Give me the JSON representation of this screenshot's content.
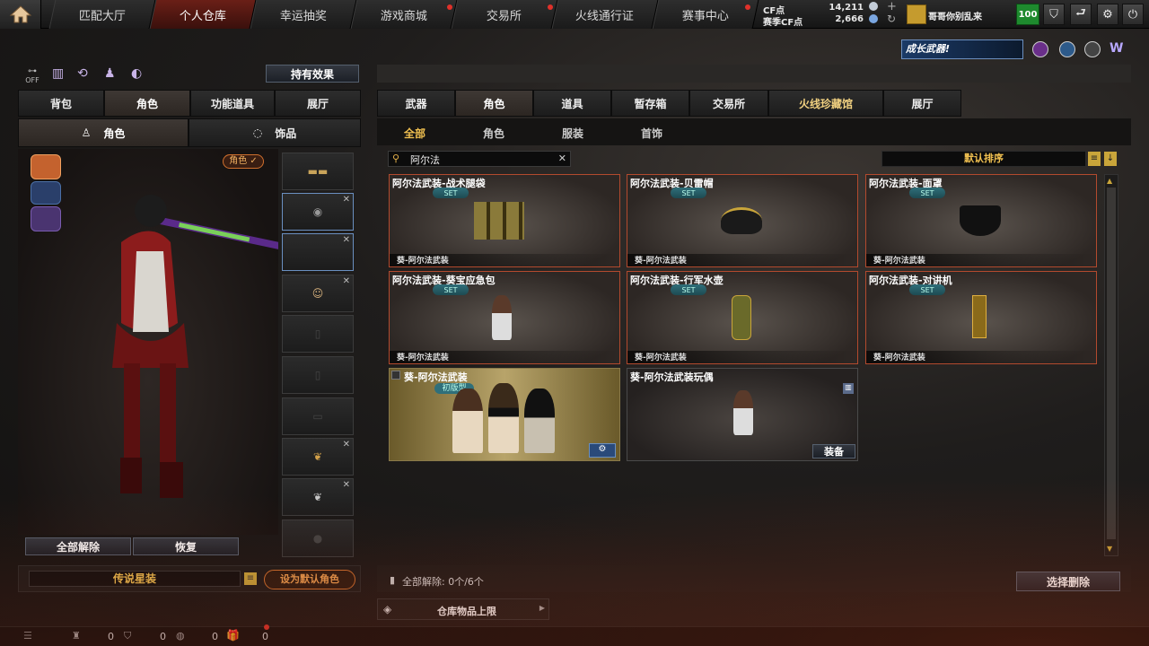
{
  "topnav": {
    "tabs": [
      "匹配大厅",
      "个人仓库",
      "幸运抽奖",
      "游戏商城",
      "交易所",
      "火线通行证",
      "赛事中心"
    ],
    "active": 1,
    "currency": {
      "cf_label": "CF点",
      "cf_value": "14,211",
      "match_label": "赛季CF点",
      "match_value": "2,666"
    },
    "username": "哥哥你别乱来",
    "level": "100"
  },
  "banner": {
    "text": "成长武器!"
  },
  "left": {
    "effect_button": "持有效果",
    "off_label": "OFF",
    "main_tabs": [
      "背包",
      "角色",
      "功能道具",
      "展厅"
    ],
    "main_active": 1,
    "sub_tabs": [
      "角色",
      "饰品"
    ],
    "role_badge": "角色 ✓",
    "clear_all": "全部解除",
    "restore": "恢复",
    "preset_name": "传说星装",
    "set_default": "设为默认角色"
  },
  "right": {
    "tabs": [
      "武器",
      "角色",
      "道具",
      "暂存箱",
      "交易所",
      "火线珍藏馆",
      "展厅"
    ],
    "active": 1,
    "subtabs": [
      "全部",
      "角色",
      "服装",
      "首饰"
    ],
    "sub_active": 0,
    "search": {
      "value": "阿尔法"
    },
    "sort_label": "默认排序",
    "items": [
      {
        "name": "阿尔法武装-战术腿袋",
        "set": "SET",
        "foot": "葵-阿尔法武装"
      },
      {
        "name": "阿尔法武装-贝雷帽",
        "set": "SET",
        "foot": "葵-阿尔法武装"
      },
      {
        "name": "阿尔法武装-面罩",
        "set": "SET",
        "foot": "葵-阿尔法武装"
      },
      {
        "name": "阿尔法武装-葵宝应急包",
        "set": "SET",
        "foot": "葵-阿尔法武装"
      },
      {
        "name": "阿尔法武装-行军水壶",
        "set": "SET",
        "foot": "葵-阿尔法武装"
      },
      {
        "name": "阿尔法武装-对讲机",
        "set": "SET",
        "foot": "葵-阿尔法武装"
      }
    ],
    "char_card": {
      "name": "葵-阿尔法武装",
      "badge": "初版型"
    },
    "toy_card": {
      "name": "葵-阿尔法武装玩偶",
      "equip": "装备"
    },
    "footer_left": "全部解除: 0个/6个",
    "select_delete": "选择删除",
    "storage_limit": "仓库物品上限"
  },
  "statusbar": {
    "c1": "0",
    "c2": "0",
    "c3": "0",
    "c4": "0"
  }
}
